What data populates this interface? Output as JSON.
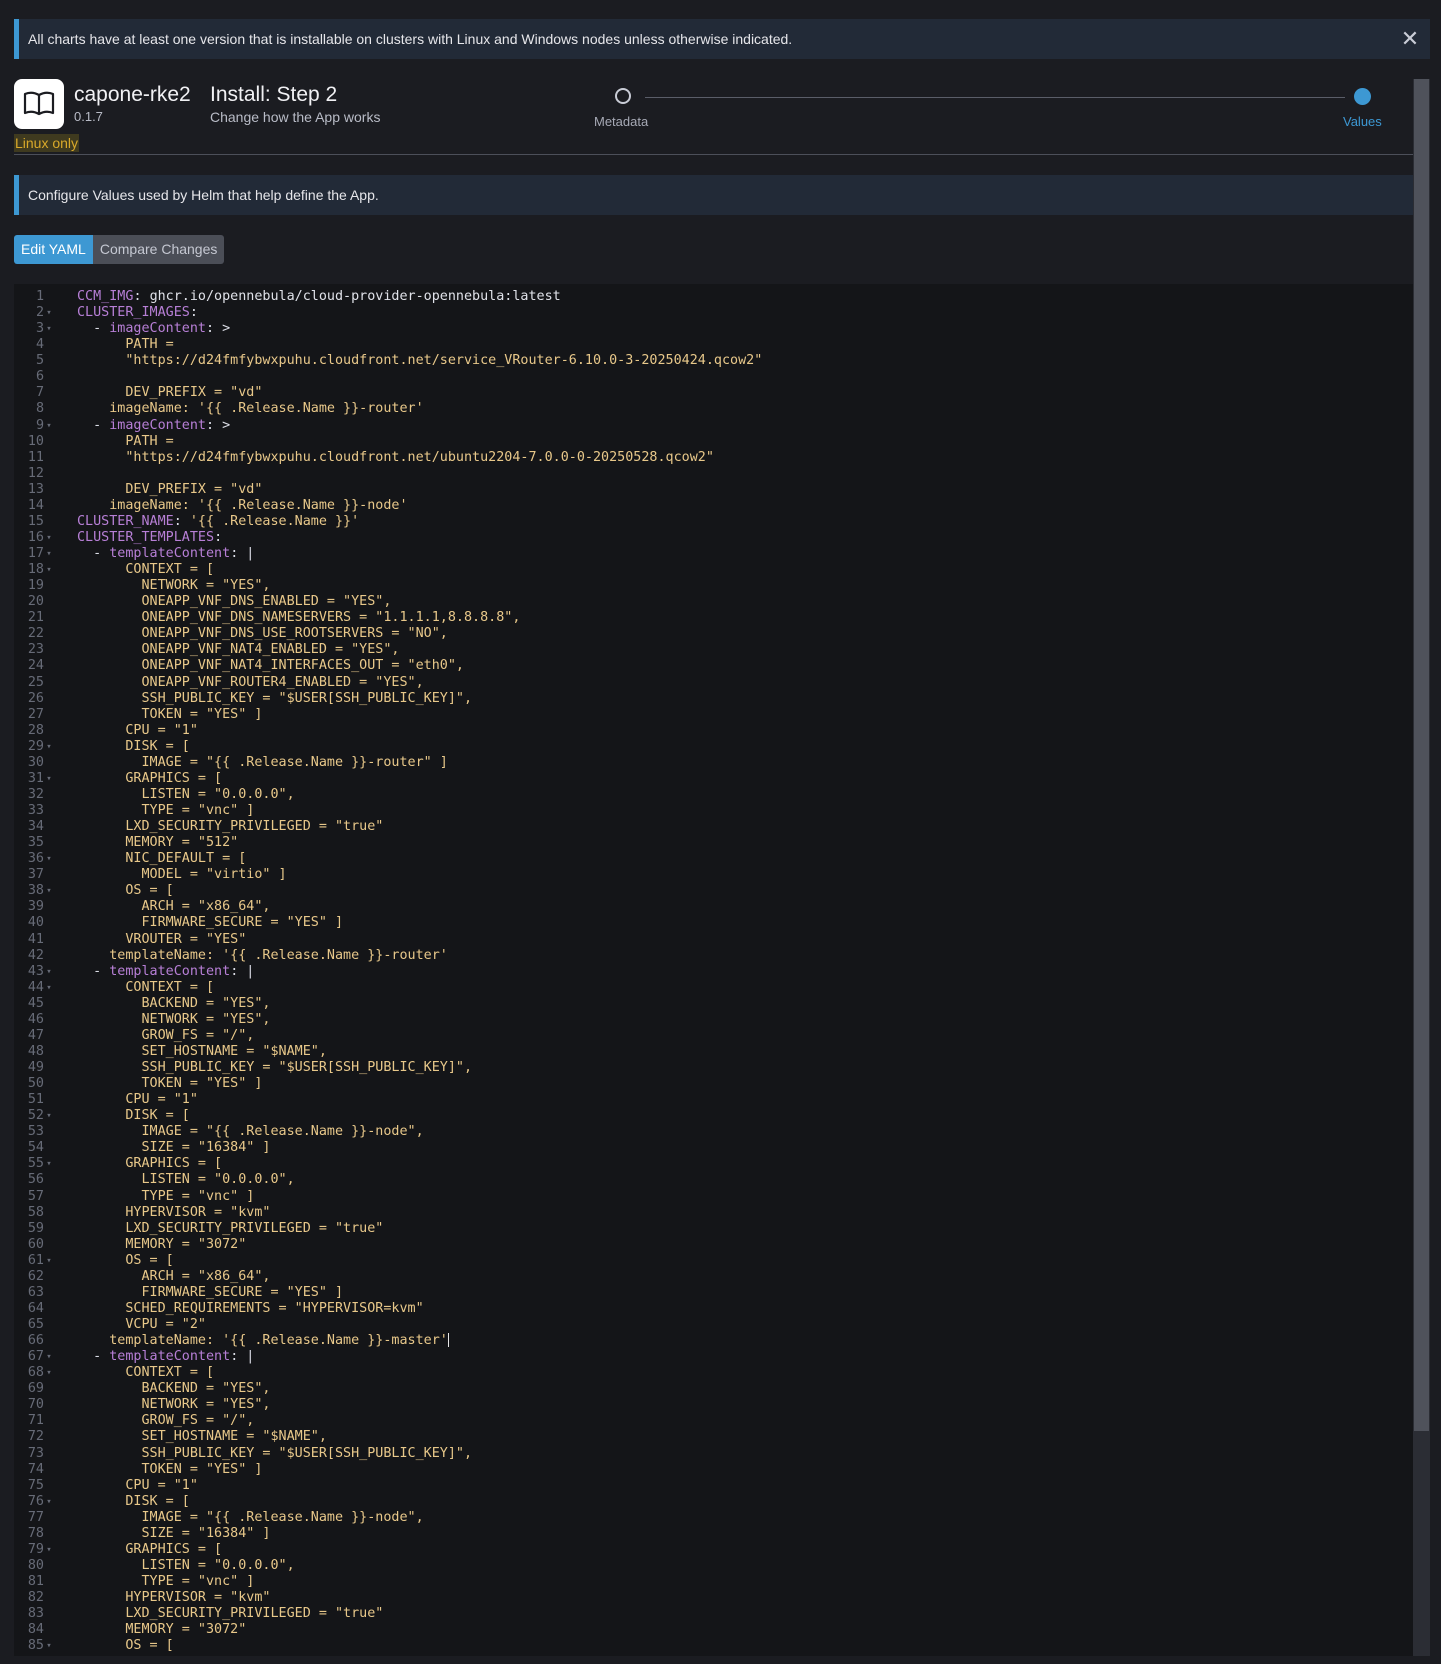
{
  "banner": {
    "text": "All charts have at least one version that is installable on clusters with Linux and Windows nodes unless otherwise indicated.",
    "close_icon": "close-icon"
  },
  "app": {
    "name": "capone-rke2",
    "version": "0.1.7",
    "platform_badge": "Linux only",
    "icon": "book-icon"
  },
  "step": {
    "title": "Install: Step 2",
    "subtitle": "Change how the App works"
  },
  "wizard": {
    "steps": [
      {
        "label": "Metadata",
        "state": "done"
      },
      {
        "label": "Values",
        "state": "active"
      }
    ]
  },
  "info": {
    "text": "Configure Values used by Helm that help define the App."
  },
  "buttons": {
    "edit_yaml": "Edit YAML",
    "compare_changes": "Compare Changes"
  },
  "colors": {
    "accent": "#3d98d3",
    "warning": "#d9a92a",
    "background": "#1b1c21",
    "editor_background": "#141518",
    "yaml_key": "#b77fd6",
    "yaml_string": "#e8c88a"
  },
  "editor": {
    "lines": [
      {
        "n": "1",
        "fold": false,
        "parts": [
          {
            "t": "CCM_IMG",
            "c": "k"
          },
          {
            "t": ": ",
            "c": "p"
          },
          {
            "t": "ghcr.io/opennebula/cloud-provider-opennebula:latest",
            "c": "v"
          }
        ]
      },
      {
        "n": "2",
        "fold": true,
        "parts": [
          {
            "t": "CLUSTER_IMAGES",
            "c": "k"
          },
          {
            "t": ":",
            "c": "p"
          }
        ]
      },
      {
        "n": "3",
        "fold": true,
        "parts": [
          {
            "t": "  - ",
            "c": "p"
          },
          {
            "t": "imageContent",
            "c": "k"
          },
          {
            "t": ": >",
            "c": "p"
          }
        ]
      },
      {
        "n": "4",
        "fold": false,
        "parts": [
          {
            "t": "      PATH =",
            "c": "s"
          }
        ]
      },
      {
        "n": "5",
        "fold": false,
        "parts": [
          {
            "t": "      \"https://d24fmfybwxpuhu.cloudfront.net/service_VRouter-6.10.0-3-20250424.qcow2\"",
            "c": "s"
          }
        ]
      },
      {
        "n": "6",
        "fold": false,
        "parts": [
          {
            "t": "",
            "c": "s"
          }
        ]
      },
      {
        "n": "7",
        "fold": false,
        "parts": [
          {
            "t": "      DEV_PREFIX = \"vd\"",
            "c": "s"
          }
        ]
      },
      {
        "n": "8",
        "fold": false,
        "parts": [
          {
            "t": "    imageName: '{{ .Release.Name }}-router'",
            "c": "s"
          }
        ]
      },
      {
        "n": "9",
        "fold": true,
        "parts": [
          {
            "t": "  - ",
            "c": "p"
          },
          {
            "t": "imageContent",
            "c": "k"
          },
          {
            "t": ": >",
            "c": "p"
          }
        ]
      },
      {
        "n": "10",
        "fold": false,
        "parts": [
          {
            "t": "      PATH =",
            "c": "s"
          }
        ]
      },
      {
        "n": "11",
        "fold": false,
        "parts": [
          {
            "t": "      \"https://d24fmfybwxpuhu.cloudfront.net/ubuntu2204-7.0.0-0-20250528.qcow2\"",
            "c": "s"
          }
        ]
      },
      {
        "n": "12",
        "fold": false,
        "parts": [
          {
            "t": "",
            "c": "s"
          }
        ]
      },
      {
        "n": "13",
        "fold": false,
        "parts": [
          {
            "t": "      DEV_PREFIX = \"vd\"",
            "c": "s"
          }
        ]
      },
      {
        "n": "14",
        "fold": false,
        "parts": [
          {
            "t": "    imageName: '{{ .Release.Name }}-node'",
            "c": "s"
          }
        ]
      },
      {
        "n": "15",
        "fold": false,
        "parts": [
          {
            "t": "CLUSTER_NAME",
            "c": "k"
          },
          {
            "t": ": ",
            "c": "p"
          },
          {
            "t": "'{{ .Release.Name }}'",
            "c": "s"
          }
        ]
      },
      {
        "n": "16",
        "fold": true,
        "parts": [
          {
            "t": "CLUSTER_TEMPLATES",
            "c": "k"
          },
          {
            "t": ":",
            "c": "p"
          }
        ]
      },
      {
        "n": "17",
        "fold": true,
        "parts": [
          {
            "t": "  - ",
            "c": "p"
          },
          {
            "t": "templateContent",
            "c": "k"
          },
          {
            "t": ": |",
            "c": "p"
          }
        ]
      },
      {
        "n": "18",
        "fold": true,
        "parts": [
          {
            "t": "      CONTEXT = [",
            "c": "s"
          }
        ]
      },
      {
        "n": "19",
        "fold": false,
        "parts": [
          {
            "t": "        NETWORK = \"YES\",",
            "c": "s"
          }
        ]
      },
      {
        "n": "20",
        "fold": false,
        "parts": [
          {
            "t": "        ONEAPP_VNF_DNS_ENABLED = \"YES\",",
            "c": "s"
          }
        ]
      },
      {
        "n": "21",
        "fold": false,
        "parts": [
          {
            "t": "        ONEAPP_VNF_DNS_NAMESERVERS = \"1.1.1.1,8.8.8.8\",",
            "c": "s"
          }
        ]
      },
      {
        "n": "22",
        "fold": false,
        "parts": [
          {
            "t": "        ONEAPP_VNF_DNS_USE_ROOTSERVERS = \"NO\",",
            "c": "s"
          }
        ]
      },
      {
        "n": "23",
        "fold": false,
        "parts": [
          {
            "t": "        ONEAPP_VNF_NAT4_ENABLED = \"YES\",",
            "c": "s"
          }
        ]
      },
      {
        "n": "24",
        "fold": false,
        "parts": [
          {
            "t": "        ONEAPP_VNF_NAT4_INTERFACES_OUT = \"eth0\",",
            "c": "s"
          }
        ]
      },
      {
        "n": "25",
        "fold": false,
        "parts": [
          {
            "t": "        ONEAPP_VNF_ROUTER4_ENABLED = \"YES\",",
            "c": "s"
          }
        ]
      },
      {
        "n": "26",
        "fold": false,
        "parts": [
          {
            "t": "        SSH_PUBLIC_KEY = \"$USER[SSH_PUBLIC_KEY]\",",
            "c": "s"
          }
        ]
      },
      {
        "n": "27",
        "fold": false,
        "parts": [
          {
            "t": "        TOKEN = \"YES\" ]",
            "c": "s"
          }
        ]
      },
      {
        "n": "28",
        "fold": false,
        "parts": [
          {
            "t": "      CPU = \"1\"",
            "c": "s"
          }
        ]
      },
      {
        "n": "29",
        "fold": true,
        "parts": [
          {
            "t": "      DISK = [",
            "c": "s"
          }
        ]
      },
      {
        "n": "30",
        "fold": false,
        "parts": [
          {
            "t": "        IMAGE = \"{{ .Release.Name }}-router\" ]",
            "c": "s"
          }
        ]
      },
      {
        "n": "31",
        "fold": true,
        "parts": [
          {
            "t": "      GRAPHICS = [",
            "c": "s"
          }
        ]
      },
      {
        "n": "32",
        "fold": false,
        "parts": [
          {
            "t": "        LISTEN = \"0.0.0.0\",",
            "c": "s"
          }
        ]
      },
      {
        "n": "33",
        "fold": false,
        "parts": [
          {
            "t": "        TYPE = \"vnc\" ]",
            "c": "s"
          }
        ]
      },
      {
        "n": "34",
        "fold": false,
        "parts": [
          {
            "t": "      LXD_SECURITY_PRIVILEGED = \"true\"",
            "c": "s"
          }
        ]
      },
      {
        "n": "35",
        "fold": false,
        "parts": [
          {
            "t": "      MEMORY = \"512\"",
            "c": "s"
          }
        ]
      },
      {
        "n": "36",
        "fold": true,
        "parts": [
          {
            "t": "      NIC_DEFAULT = [",
            "c": "s"
          }
        ]
      },
      {
        "n": "37",
        "fold": false,
        "parts": [
          {
            "t": "        MODEL = \"virtio\" ]",
            "c": "s"
          }
        ]
      },
      {
        "n": "38",
        "fold": true,
        "parts": [
          {
            "t": "      OS = [",
            "c": "s"
          }
        ]
      },
      {
        "n": "39",
        "fold": false,
        "parts": [
          {
            "t": "        ARCH = \"x86_64\",",
            "c": "s"
          }
        ]
      },
      {
        "n": "40",
        "fold": false,
        "parts": [
          {
            "t": "        FIRMWARE_SECURE = \"YES\" ]",
            "c": "s"
          }
        ]
      },
      {
        "n": "41",
        "fold": false,
        "parts": [
          {
            "t": "      VROUTER = \"YES\"",
            "c": "s"
          }
        ]
      },
      {
        "n": "42",
        "fold": false,
        "parts": [
          {
            "t": "    templateName: '{{ .Release.Name }}-router'",
            "c": "s"
          }
        ]
      },
      {
        "n": "43",
        "fold": true,
        "parts": [
          {
            "t": "  - ",
            "c": "p"
          },
          {
            "t": "templateContent",
            "c": "k"
          },
          {
            "t": ": |",
            "c": "p"
          }
        ]
      },
      {
        "n": "44",
        "fold": true,
        "parts": [
          {
            "t": "      CONTEXT = [",
            "c": "s"
          }
        ]
      },
      {
        "n": "45",
        "fold": false,
        "parts": [
          {
            "t": "        BACKEND = \"YES\",",
            "c": "s"
          }
        ]
      },
      {
        "n": "46",
        "fold": false,
        "parts": [
          {
            "t": "        NETWORK = \"YES\",",
            "c": "s"
          }
        ]
      },
      {
        "n": "47",
        "fold": false,
        "parts": [
          {
            "t": "        GROW_FS = \"/\",",
            "c": "s"
          }
        ]
      },
      {
        "n": "48",
        "fold": false,
        "parts": [
          {
            "t": "        SET_HOSTNAME = \"$NAME\",",
            "c": "s"
          }
        ]
      },
      {
        "n": "49",
        "fold": false,
        "parts": [
          {
            "t": "        SSH_PUBLIC_KEY = \"$USER[SSH_PUBLIC_KEY]\",",
            "c": "s"
          }
        ]
      },
      {
        "n": "50",
        "fold": false,
        "parts": [
          {
            "t": "        TOKEN = \"YES\" ]",
            "c": "s"
          }
        ]
      },
      {
        "n": "51",
        "fold": false,
        "parts": [
          {
            "t": "      CPU = \"1\"",
            "c": "s"
          }
        ]
      },
      {
        "n": "52",
        "fold": true,
        "parts": [
          {
            "t": "      DISK = [",
            "c": "s"
          }
        ]
      },
      {
        "n": "53",
        "fold": false,
        "parts": [
          {
            "t": "        IMAGE = \"{{ .Release.Name }}-node\",",
            "c": "s"
          }
        ]
      },
      {
        "n": "54",
        "fold": false,
        "parts": [
          {
            "t": "        SIZE = \"16384\" ]",
            "c": "s"
          }
        ]
      },
      {
        "n": "55",
        "fold": true,
        "parts": [
          {
            "t": "      GRAPHICS = [",
            "c": "s"
          }
        ]
      },
      {
        "n": "56",
        "fold": false,
        "parts": [
          {
            "t": "        LISTEN = \"0.0.0.0\",",
            "c": "s"
          }
        ]
      },
      {
        "n": "57",
        "fold": false,
        "parts": [
          {
            "t": "        TYPE = \"vnc\" ]",
            "c": "s"
          }
        ]
      },
      {
        "n": "58",
        "fold": false,
        "parts": [
          {
            "t": "      HYPERVISOR = \"kvm\"",
            "c": "s"
          }
        ]
      },
      {
        "n": "59",
        "fold": false,
        "parts": [
          {
            "t": "      LXD_SECURITY_PRIVILEGED = \"true\"",
            "c": "s"
          }
        ]
      },
      {
        "n": "60",
        "fold": false,
        "parts": [
          {
            "t": "      MEMORY = \"3072\"",
            "c": "s"
          }
        ]
      },
      {
        "n": "61",
        "fold": true,
        "parts": [
          {
            "t": "      OS = [",
            "c": "s"
          }
        ]
      },
      {
        "n": "62",
        "fold": false,
        "parts": [
          {
            "t": "        ARCH = \"x86_64\",",
            "c": "s"
          }
        ]
      },
      {
        "n": "63",
        "fold": false,
        "parts": [
          {
            "t": "        FIRMWARE_SECURE = \"YES\" ]",
            "c": "s"
          }
        ]
      },
      {
        "n": "64",
        "fold": false,
        "parts": [
          {
            "t": "      SCHED_REQUIREMENTS = \"HYPERVISOR=kvm\"",
            "c": "s"
          }
        ]
      },
      {
        "n": "65",
        "fold": false,
        "parts": [
          {
            "t": "      VCPU = \"2\"",
            "c": "s"
          }
        ]
      },
      {
        "n": "66",
        "fold": false,
        "cursor": true,
        "parts": [
          {
            "t": "    templateName: '{{ .Release.Name }}-master'",
            "c": "s"
          }
        ]
      },
      {
        "n": "67",
        "fold": true,
        "parts": [
          {
            "t": "  - ",
            "c": "p"
          },
          {
            "t": "templateContent",
            "c": "k"
          },
          {
            "t": ": |",
            "c": "p"
          }
        ]
      },
      {
        "n": "68",
        "fold": true,
        "parts": [
          {
            "t": "      CONTEXT = [",
            "c": "s"
          }
        ]
      },
      {
        "n": "69",
        "fold": false,
        "parts": [
          {
            "t": "        BACKEND = \"YES\",",
            "c": "s"
          }
        ]
      },
      {
        "n": "70",
        "fold": false,
        "parts": [
          {
            "t": "        NETWORK = \"YES\",",
            "c": "s"
          }
        ]
      },
      {
        "n": "71",
        "fold": false,
        "parts": [
          {
            "t": "        GROW_FS = \"/\",",
            "c": "s"
          }
        ]
      },
      {
        "n": "72",
        "fold": false,
        "parts": [
          {
            "t": "        SET_HOSTNAME = \"$NAME\",",
            "c": "s"
          }
        ]
      },
      {
        "n": "73",
        "fold": false,
        "parts": [
          {
            "t": "        SSH_PUBLIC_KEY = \"$USER[SSH_PUBLIC_KEY]\",",
            "c": "s"
          }
        ]
      },
      {
        "n": "74",
        "fold": false,
        "parts": [
          {
            "t": "        TOKEN = \"YES\" ]",
            "c": "s"
          }
        ]
      },
      {
        "n": "75",
        "fold": false,
        "parts": [
          {
            "t": "      CPU = \"1\"",
            "c": "s"
          }
        ]
      },
      {
        "n": "76",
        "fold": true,
        "parts": [
          {
            "t": "      DISK = [",
            "c": "s"
          }
        ]
      },
      {
        "n": "77",
        "fold": false,
        "parts": [
          {
            "t": "        IMAGE = \"{{ .Release.Name }}-node\",",
            "c": "s"
          }
        ]
      },
      {
        "n": "78",
        "fold": false,
        "parts": [
          {
            "t": "        SIZE = \"16384\" ]",
            "c": "s"
          }
        ]
      },
      {
        "n": "79",
        "fold": true,
        "parts": [
          {
            "t": "      GRAPHICS = [",
            "c": "s"
          }
        ]
      },
      {
        "n": "80",
        "fold": false,
        "parts": [
          {
            "t": "        LISTEN = \"0.0.0.0\",",
            "c": "s"
          }
        ]
      },
      {
        "n": "81",
        "fold": false,
        "parts": [
          {
            "t": "        TYPE = \"vnc\" ]",
            "c": "s"
          }
        ]
      },
      {
        "n": "82",
        "fold": false,
        "parts": [
          {
            "t": "      HYPERVISOR = \"kvm\"",
            "c": "s"
          }
        ]
      },
      {
        "n": "83",
        "fold": false,
        "parts": [
          {
            "t": "      LXD_SECURITY_PRIVILEGED = \"true\"",
            "c": "s"
          }
        ]
      },
      {
        "n": "84",
        "fold": false,
        "parts": [
          {
            "t": "      MEMORY = \"3072\"",
            "c": "s"
          }
        ]
      },
      {
        "n": "85",
        "fold": true,
        "parts": [
          {
            "t": "      OS = [",
            "c": "s"
          }
        ]
      }
    ]
  }
}
